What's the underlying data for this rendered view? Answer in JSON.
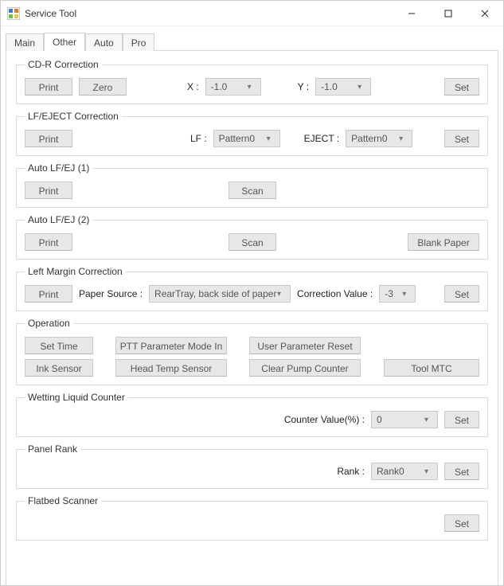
{
  "window": {
    "title": "Service Tool"
  },
  "tabs": {
    "t0": "Main",
    "t1": "Other",
    "t2": "Auto",
    "t3": "Pro",
    "active": 1
  },
  "groups": {
    "cdr": {
      "title": "CD-R Correction",
      "print": "Print",
      "zero": "Zero",
      "x_label": "X :",
      "x_value": "-1.0",
      "y_label": "Y :",
      "y_value": "-1.0",
      "set": "Set"
    },
    "lf_eject": {
      "title": "LF/EJECT Correction",
      "print": "Print",
      "lf_label": "LF :",
      "lf_value": "Pattern0",
      "eject_label": "EJECT :",
      "eject_value": "Pattern0",
      "set": "Set"
    },
    "auto1": {
      "title": "Auto LF/EJ (1)",
      "print": "Print",
      "scan": "Scan"
    },
    "auto2": {
      "title": "Auto LF/EJ (2)",
      "print": "Print",
      "scan": "Scan",
      "blank": "Blank Paper"
    },
    "leftmargin": {
      "title": "Left Margin Correction",
      "print": "Print",
      "paper_source_label": "Paper Source :",
      "paper_source_value": "RearTray, back side of paper",
      "correction_label": "Correction Value :",
      "correction_value": "-3",
      "set": "Set"
    },
    "operation": {
      "title": "Operation",
      "set_time": "Set Time",
      "ptt": "PTT Parameter Mode In",
      "user_reset": "User Parameter Reset",
      "ink_sensor": "Ink Sensor",
      "head_temp": "Head Temp Sensor",
      "clear_pump": "Clear Pump Counter",
      "tool_mtc": "Tool MTC"
    },
    "wetting": {
      "title": "Wetting Liquid Counter",
      "counter_label": "Counter Value(%) :",
      "counter_value": "0",
      "set": "Set"
    },
    "panelrank": {
      "title": "Panel Rank",
      "rank_label": "Rank :",
      "rank_value": "Rank0",
      "set": "Set"
    },
    "flatbed": {
      "title": "Flatbed Scanner",
      "set": "Set"
    }
  }
}
